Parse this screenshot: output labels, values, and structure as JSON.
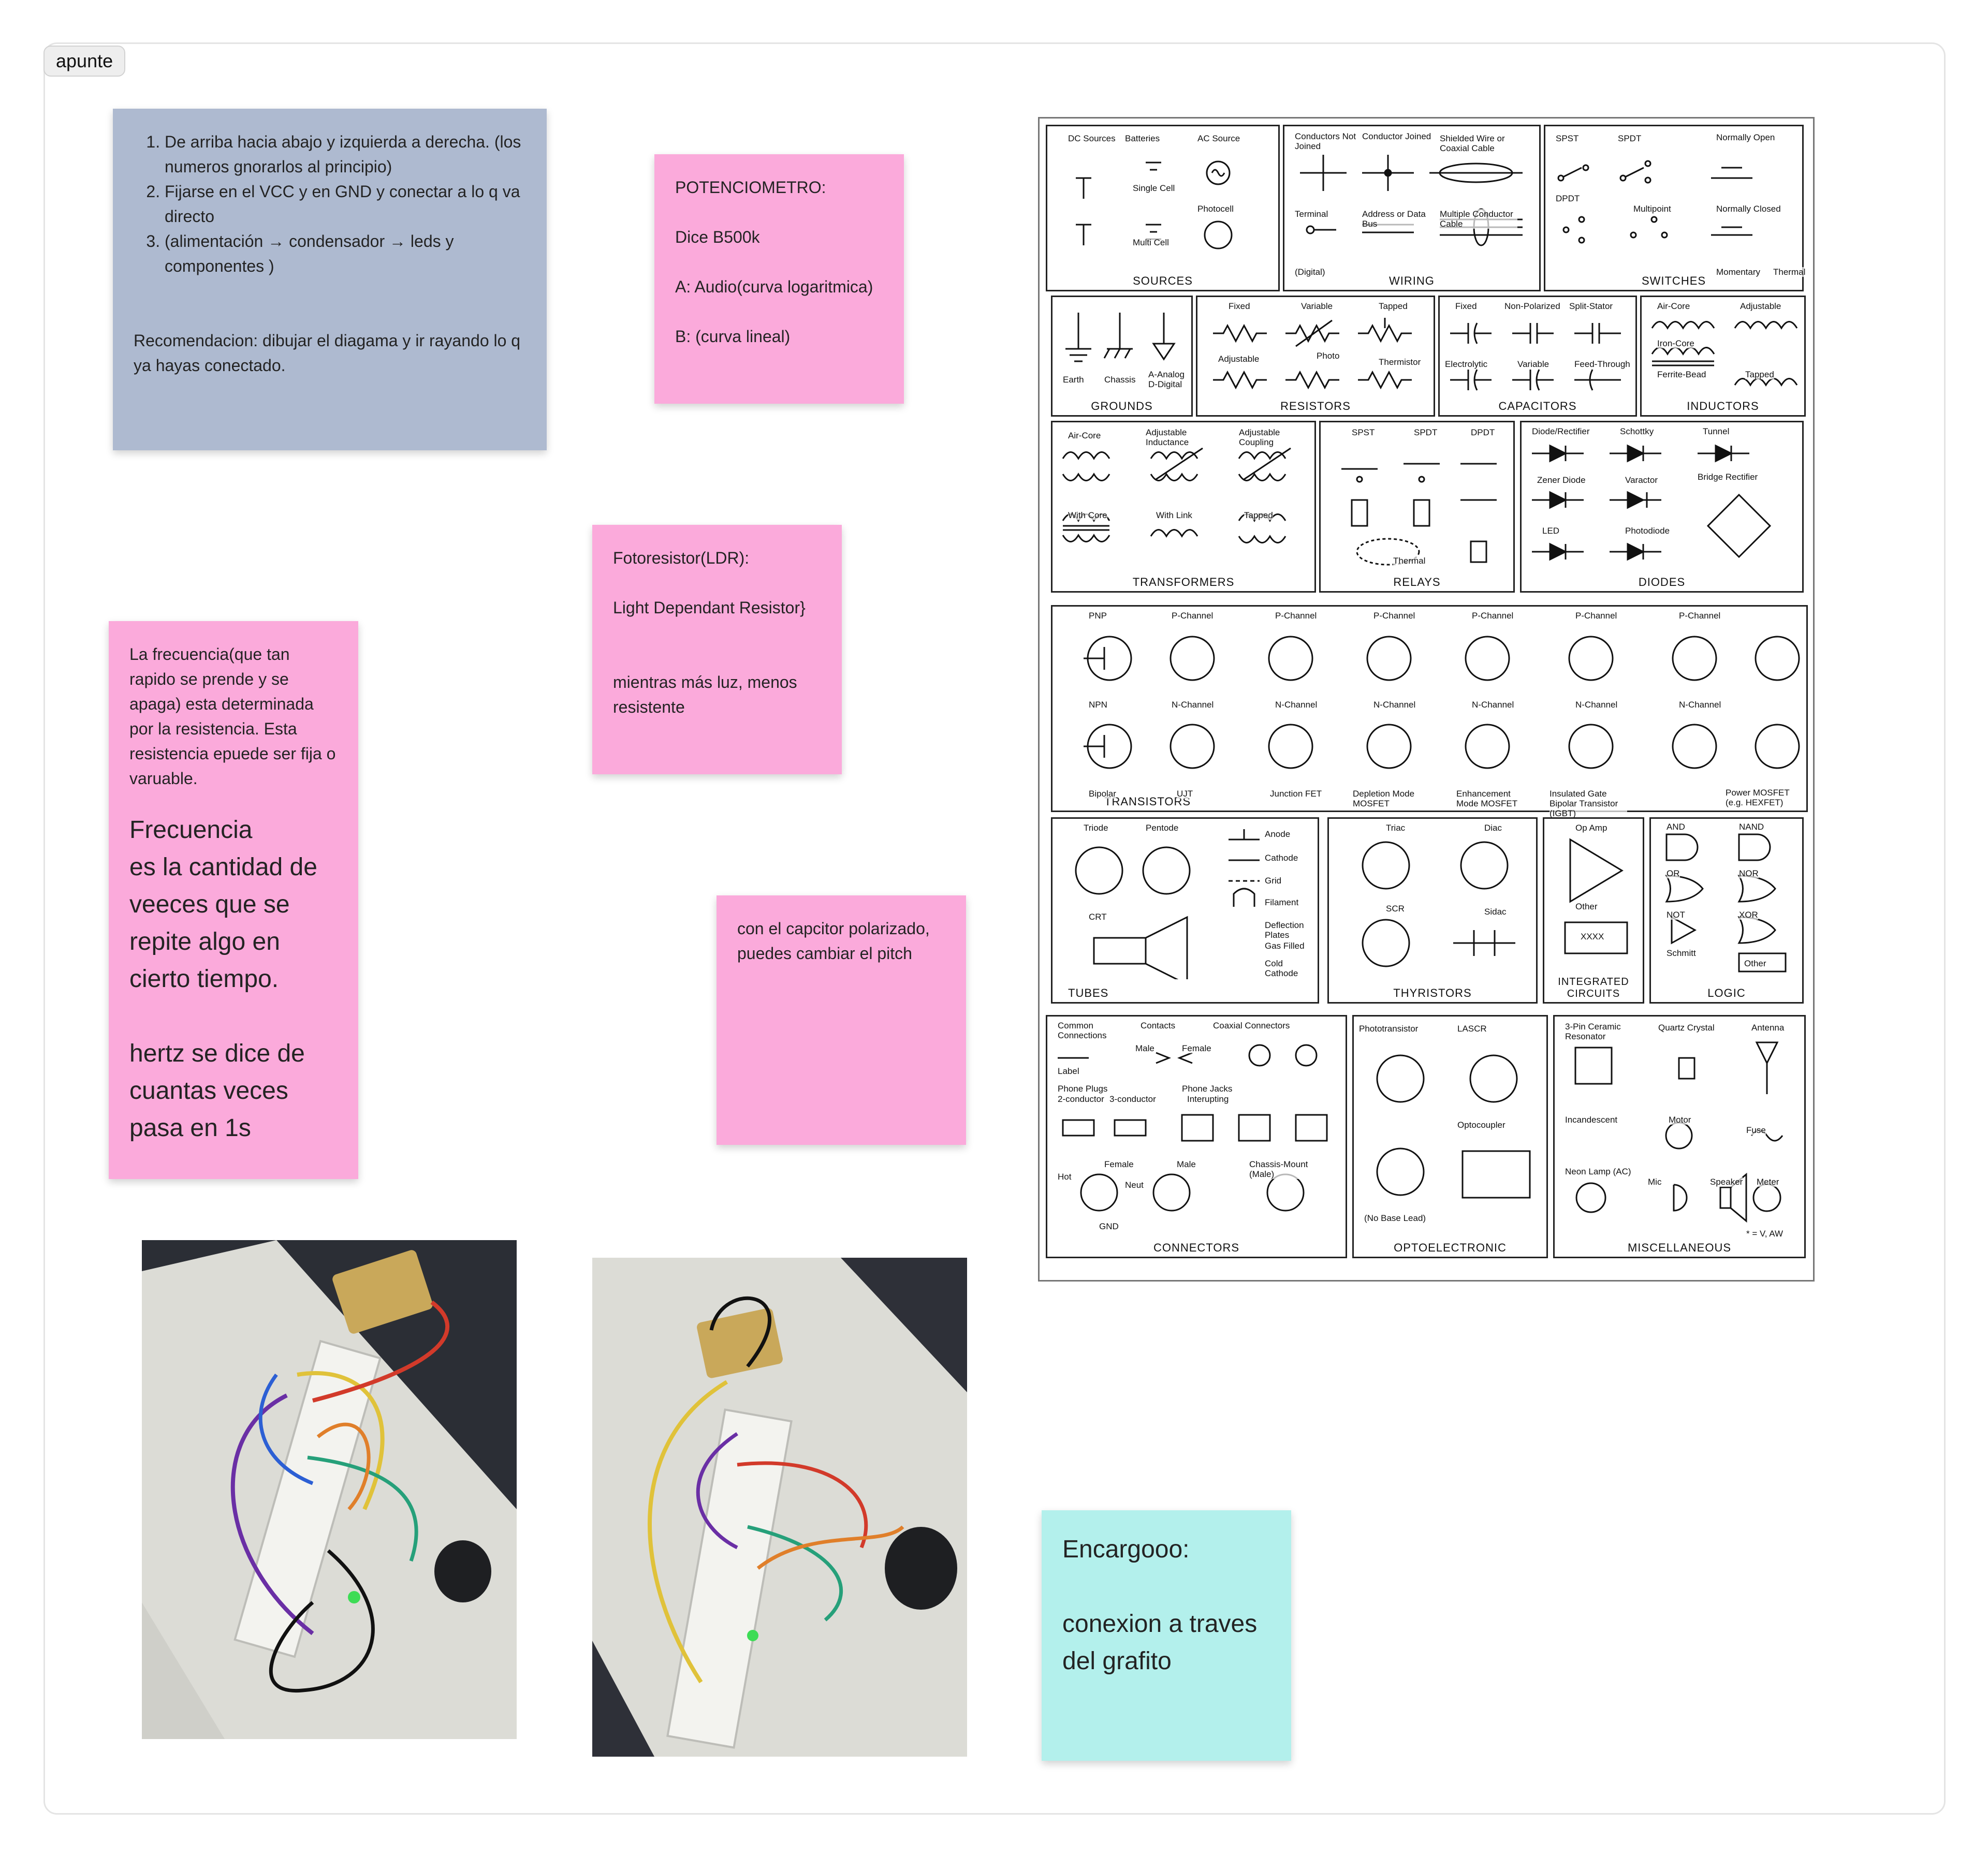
{
  "frame": {
    "label": "apunte"
  },
  "notes": {
    "instructions": {
      "items": [
        "De arriba hacia abajo y izquierda a derecha. (los numeros gnorarlos al principio)",
        "Fijarse en el VCC y en GND y conectar a lo q va directo",
        "(alimentación → condensador → leds y componentes )"
      ],
      "recommendation": "Recomendacion: dibujar el diagama y ir rayando lo q ya hayas conectado."
    },
    "potenciometro": {
      "title": "POTENCIOMETRO:",
      "line1": "Dice B500k",
      "line2": "A: Audio(curva logaritmica)",
      "line3": "B: (curva lineal)"
    },
    "fotoresistor": {
      "title": "Fotoresistor(LDR):",
      "line1": "Light Dependant Resistor}",
      "line2": "mientras más luz, menos resistente"
    },
    "frecuencia": {
      "small_text": "La frecuencia(que tan rapido se prende y se apaga) esta determinada por la resistencia. Esta resistencia epuede ser fija o varuable.",
      "large_text1": "Frecuencia\nes la cantidad de veeces que se repite algo en cierto tiempo.",
      "large_text2": "hertz se dice de cuantas veces pasa en 1s"
    },
    "capacitor": {
      "text": "con el capcitor polarizado, puedes cambiar el pitch"
    },
    "encargo": {
      "title": "Encargooo:",
      "text": "conexion a traves del grafito"
    }
  },
  "chart": {
    "panels": {
      "sources": "SOURCES",
      "wiring": "WIRING",
      "switches": "SWITCHES",
      "grounds": "GROUNDS",
      "resistors": "RESISTORS",
      "capacitors": "CAPACITORS",
      "inductors": "INDUCTORS",
      "transformers": "TRANSFORMERS",
      "relays": "RELAYS",
      "diodes": "DIODES",
      "transistors": "TRANSISTORS",
      "tubes": "TUBES",
      "thyristors": "THYRISTORS",
      "integrated_circuits": "INTEGRATED CIRCUITS",
      "logic": "LOGIC",
      "connectors": "CONNECTORS",
      "optoelectronic": "OPTOELECTRONIC",
      "miscellaneous": "MISCELLANEOUS"
    },
    "labels": {
      "sources": [
        "DC Sources",
        "Batteries",
        "AC Source",
        "Single Cell",
        "Photocell",
        "Multi Cell"
      ],
      "wiring": [
        "Conductors Not Joined",
        "Conductor Joined",
        "Shielded Wire or Coaxial Cable",
        "Terminal",
        "Address or Data Bus",
        "Multiple Conductor Cable",
        "(Digital)"
      ],
      "switches": [
        "SPST",
        "SPDT",
        "Normally Open",
        "DPDT",
        "Multipoint",
        "Normally Closed",
        "Momentary",
        "Thermal"
      ],
      "grounds": [
        "Earth",
        "Chassis",
        "A-Analog D-Digital"
      ],
      "resistors": [
        "Fixed",
        "Variable",
        "Tapped",
        "Adjustable",
        "Photo",
        "Thermistor"
      ],
      "capacitors": [
        "Fixed",
        "Non-Polarized",
        "Split-Stator",
        "Electrolytic",
        "Variable",
        "Feed-Through"
      ],
      "inductors": [
        "Air-Core",
        "Adjustable",
        "Iron-Core",
        "Ferrite-Bead",
        "Tapped"
      ],
      "transformers": [
        "Air-Core",
        "Adjustable Inductance",
        "Adjustable Coupling",
        "With Core",
        "With Link",
        "Tapped"
      ],
      "relays": [
        "SPST",
        "SPDT",
        "DPDT",
        "Thermal"
      ],
      "diodes": [
        "Diode/Rectifier",
        "Schottky",
        "Tunnel",
        "Zener Diode",
        "Varactor",
        "Bridge Rectifier",
        "LED",
        "Photodiode"
      ],
      "transistors": [
        "PNP",
        "P-Channel",
        "P-Channel",
        "P-Channel",
        "P-Channel",
        "P-Channel",
        "P-Channel",
        "NPN",
        "N-Channel",
        "N-Channel",
        "N-Channel",
        "N-Channel",
        "N-Channel",
        "N-Channel",
        "Bipolar",
        "UJT",
        "Junction FET",
        "Depletion Mode MOSFET",
        "Enhancement Mode MOSFET",
        "Insulated Gate Bipolar Transistor (IGBT)",
        "Power MOSFET (e.g. HEXFET)"
      ],
      "tubes": [
        "Triode",
        "Pentode",
        "Anode",
        "Cathode",
        "Grid",
        "Filament",
        "Deflection Plates",
        "Gas Filled",
        "Cold Cathode",
        "CRT"
      ],
      "thyristors": [
        "Triac",
        "Diac",
        "SCR",
        "Sidac"
      ],
      "integrated_circuits": [
        "Op Amp",
        "Other",
        "XXXX"
      ],
      "logic": [
        "AND",
        "NAND",
        "OR",
        "NOR",
        "NOT",
        "XOR",
        "Schmitt",
        "Other"
      ],
      "connectors": [
        "Common Connections",
        "Contacts",
        "Coaxial Connectors",
        "Label",
        "Male",
        "Female",
        "Phone Plugs",
        "Phone Jacks",
        "2-conductor",
        "3-conductor",
        "Interupting",
        "Female",
        "Male",
        "Chassis-Mount (Male)",
        "Hot",
        "Neut",
        "GND"
      ],
      "optoelectronic": [
        "Phototransistor",
        "LASCR",
        "Optocoupler",
        "(No Base Lead)"
      ],
      "miscellaneous": [
        "3-Pin Ceramic Resonator",
        "Quartz Crystal",
        "Antenna",
        "Incandescent",
        "Motor",
        "Fuse",
        "Neon Lamp (AC)",
        "Mic",
        "Speaker",
        "Meter",
        "* = V, AW"
      ]
    }
  },
  "colors": {
    "blue_note": "#aebad0",
    "pink_note": "#fbaadb",
    "teal_note": "#b3f0ec"
  }
}
